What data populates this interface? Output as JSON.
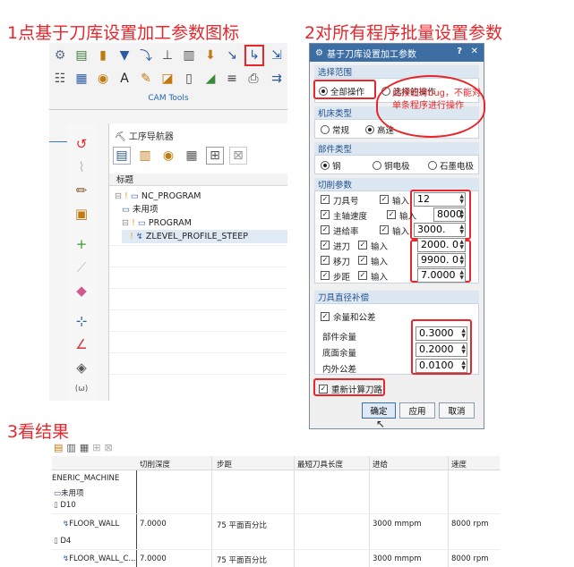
{
  "captions": {
    "step1": "1点基于刀库设置加工参数图标",
    "step2": "2对所有程序批量设置参数",
    "step3": "3看结果"
  },
  "accent": "#e8262b",
  "nx": {
    "ribbon_group": "CAM Tools",
    "navigator_title": "工序导航器",
    "column_header": "标题",
    "tree": [
      "NC_PROGRAM",
      "未用项",
      "PROGRAM",
      "ZLEVEL_PROFILE_STEEP"
    ]
  },
  "dialog": {
    "title": "基于刀库设置加工参数",
    "help": "?",
    "close": "✕",
    "scope": {
      "heading": "选择范围",
      "opt_all": "全部操作",
      "opt_selected": "选择的操作",
      "note": "此按钮有bug，不能对单条程序进行操作"
    },
    "machine": {
      "heading": "机床类型",
      "opt_normal": "常规",
      "opt_highspeed": "高速"
    },
    "part": {
      "heading": "部件类型",
      "opt_steel": "钢",
      "opt_copper": "铜电极",
      "opt_graphite": "石墨电极"
    },
    "cutting": {
      "heading": "切削参数",
      "rows": [
        {
          "label": "刀具号",
          "input": "输入",
          "value": "12"
        },
        {
          "label": "主轴速度",
          "input": "输入",
          "value": "8000"
        },
        {
          "label": "进给率",
          "input": "输入",
          "value": "3000."
        },
        {
          "label": "进刀",
          "input": "输入",
          "value": "2000. 0"
        },
        {
          "label": "移刀",
          "input": "输入",
          "value": "9900. 0"
        },
        {
          "label": "步距",
          "input": "输入",
          "value": "7.0000"
        }
      ]
    },
    "tool_dia": {
      "heading": "刀具直径补偿",
      "stock_toggle": "余量和公差",
      "rows": [
        {
          "label": "部件余量",
          "value": "0.3000"
        },
        {
          "label": "底面余量",
          "value": "0.2000"
        },
        {
          "label": "内外公差",
          "value": "0.0100"
        }
      ]
    },
    "recalc": "重新计算刀路",
    "ok": "确定",
    "apply": "应用",
    "cancel": "取消"
  },
  "result": {
    "headers": [
      "切削深度",
      "步距",
      "最短刀具长度",
      "进给",
      "速度"
    ],
    "rows": [
      {
        "name": "ENERIC_MACHINE",
        "depth": "",
        "step": "",
        "minlen": "",
        "feed": "",
        "speed": ""
      },
      {
        "name": "未用项",
        "depth": "",
        "step": "",
        "minlen": "",
        "feed": "",
        "speed": ""
      },
      {
        "name": "D10",
        "depth": "",
        "step": "",
        "minlen": "",
        "feed": "",
        "speed": ""
      },
      {
        "name": "FLOOR_WALL",
        "depth": "7.0000",
        "step": "75 平面百分比",
        "minlen": "",
        "feed": "3000 mmpm",
        "speed": "8000 rpm"
      },
      {
        "name": "D4",
        "depth": "",
        "step": "",
        "minlen": "",
        "feed": "",
        "speed": ""
      },
      {
        "name": "FLOOR_WALL_C...",
        "depth": "7.0000",
        "step": "75 平面百分比",
        "minlen": "",
        "feed": "3000 mmpm",
        "speed": "8000 rpm"
      }
    ]
  }
}
